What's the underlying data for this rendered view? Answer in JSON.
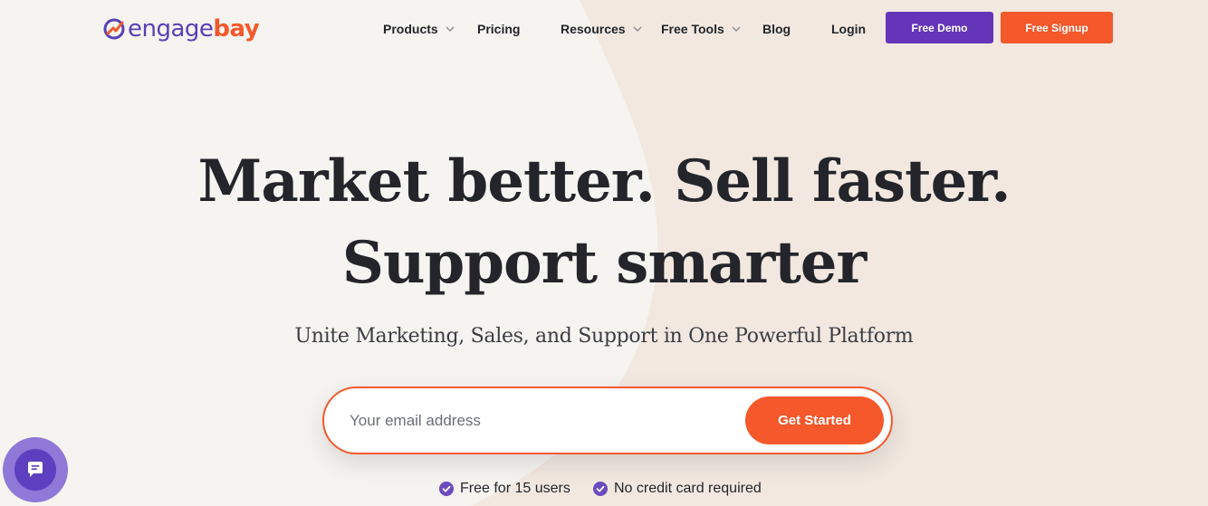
{
  "brand": {
    "name_part1": "engage",
    "name_part2": "bay",
    "primary_color": "#6435b8",
    "accent_color": "#f4582b"
  },
  "nav": {
    "products": "Products",
    "pricing": "Pricing",
    "resources": "Resources",
    "free_tools": "Free Tools",
    "blog": "Blog",
    "login": "Login",
    "free_demo": "Free Demo",
    "free_signup": "Free Signup"
  },
  "hero": {
    "headline_line1": "Market better. Sell faster.",
    "headline_line2": "Support smarter",
    "subheadline": "Unite Marketing, Sales, and Support in One Powerful Platform"
  },
  "signup_form": {
    "email_placeholder": "Your email address",
    "email_value": "",
    "submit_label": "Get Started"
  },
  "features": [
    {
      "label": "Free for 15 users",
      "icon": "check-circle-icon"
    },
    {
      "label": "No credit card required",
      "icon": "check-circle-icon"
    }
  ],
  "chat_widget": {
    "icon": "chat-icon"
  }
}
